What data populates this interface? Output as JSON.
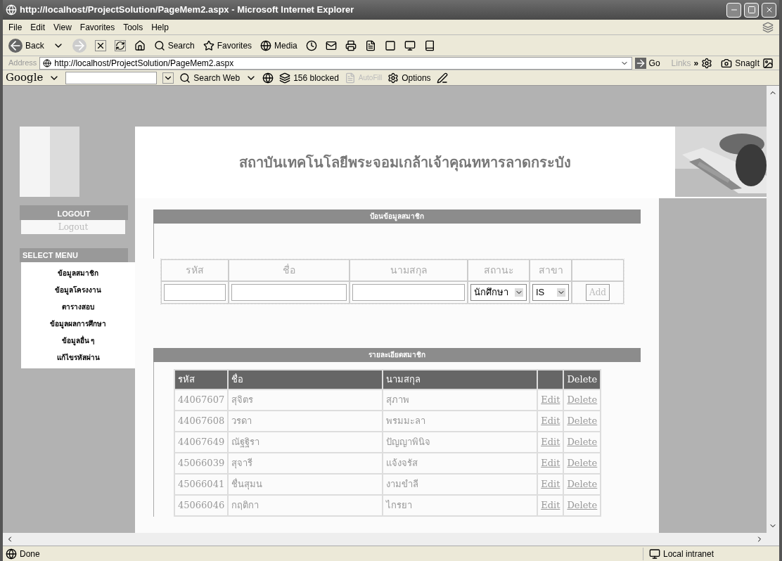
{
  "window": {
    "title": "http://localhost/ProjectSolution/PageMem2.aspx - Microsoft Internet Explorer"
  },
  "menu_bar": [
    "File",
    "Edit",
    "View",
    "Favorites",
    "Tools",
    "Help"
  ],
  "toolbar": {
    "back": "Back",
    "search": "Search",
    "favorites": "Favorites",
    "media": "Media"
  },
  "address_bar": {
    "label": "Address",
    "value": "http://localhost/ProjectSolution/PageMem2.aspx",
    "go": "Go",
    "links": "Links",
    "chevron": "»",
    "snagit": "SnagIt"
  },
  "google_bar": {
    "logo": "Google",
    "search_web": "Search Web",
    "blocked": "156 blocked",
    "autofill": "AutoFill",
    "options": "Options"
  },
  "page": {
    "banner_title": "สถาบันเทคโนโลยีพระจอมเกล้าเจ้าคุณทหารลาดกระบัง",
    "logout_heading": "LOGOUT",
    "logout_button": "Logout",
    "menu_heading": "SELECT MENU",
    "menu_items": [
      "ข้อมูลสมาชิก",
      "ข้อมูลโครงงาน",
      "ตารางสอบ",
      "ข้อมูลผลการศึกษา",
      "ข้อมูลอื่น ๆ",
      "แก้ไขรหัสผ่าน"
    ],
    "form_heading": "ป้อนข้อมูลสมาชิก",
    "form": {
      "columns": [
        "รหัส",
        "ชื่อ",
        "นามสกุล",
        "สถานะ",
        "สาขา"
      ],
      "status_value": "นักศึกษา",
      "major_value": "IS",
      "add_button": "Add"
    },
    "list_heading": "รายละเอียดสมาชิก",
    "table": {
      "columns": [
        "รหัส",
        "ชื่อ",
        "นามสกุล",
        "",
        "Delete"
      ],
      "rows": [
        {
          "id": "44067607",
          "first": "สุจิตร",
          "last": "สุภาพ",
          "edit": "Edit",
          "delete": "Delete"
        },
        {
          "id": "44067608",
          "first": "วรดา",
          "last": "พรมมะลา",
          "edit": "Edit",
          "delete": "Delete"
        },
        {
          "id": "44067649",
          "first": "ณัฐฐิรา",
          "last": "ปัญญาพินิจ",
          "edit": "Edit",
          "delete": "Delete"
        },
        {
          "id": "45066039",
          "first": "สุจารี",
          "last": "แจ้งจรัส",
          "edit": "Edit",
          "delete": "Delete"
        },
        {
          "id": "45066041",
          "first": "ชื่นสุมน",
          "last": "งามขำลี",
          "edit": "Edit",
          "delete": "Delete"
        },
        {
          "id": "45066046",
          "first": "กฤติกา",
          "last": "ไกรยา",
          "edit": "Edit",
          "delete": "Delete"
        }
      ]
    }
  },
  "status_bar": {
    "text": "Done",
    "zone": "Local intranet"
  }
}
